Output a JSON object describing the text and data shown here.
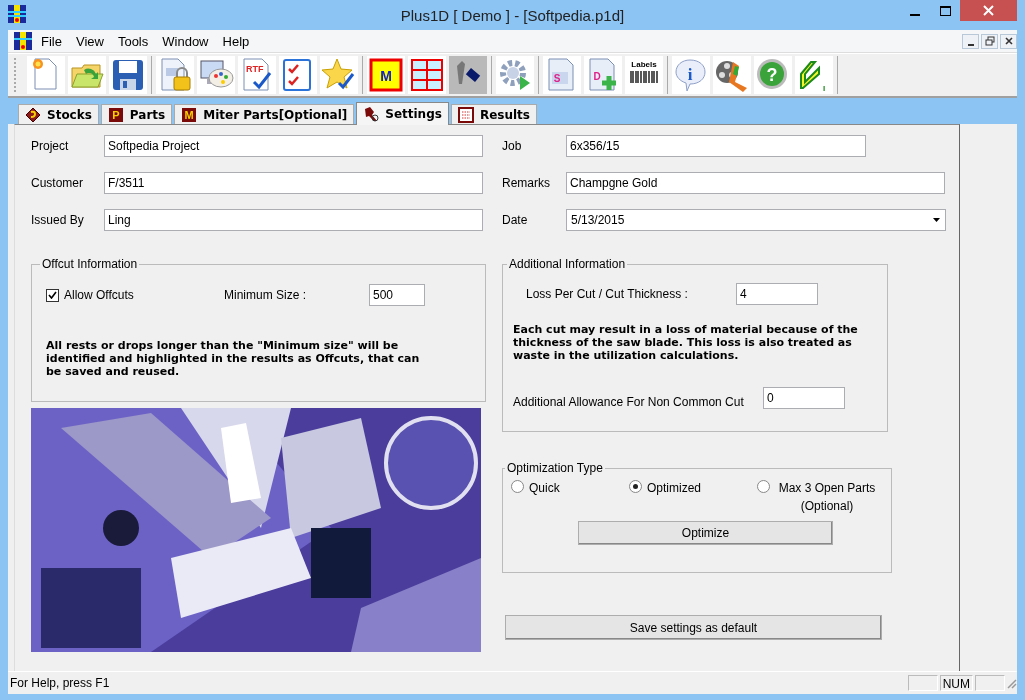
{
  "window": {
    "title": "Plus1D [ Demo ] - [Softpedia.p1d]"
  },
  "menu": [
    {
      "label": "File"
    },
    {
      "label": "View"
    },
    {
      "label": "Tools"
    },
    {
      "label": "Window"
    },
    {
      "label": "Help"
    }
  ],
  "toolbar": [
    [
      {
        "kind": "new-document"
      },
      {
        "kind": "open-folder"
      },
      {
        "kind": "floppy"
      }
    ],
    [
      {
        "kind": "lock-document"
      },
      {
        "kind": "palette"
      },
      {
        "kind": "rtf-document",
        "glyph": "RTF"
      },
      {
        "kind": "checklist"
      },
      {
        "kind": "star-check"
      }
    ],
    [
      {
        "kind": "letter-box",
        "glyph": "M"
      },
      {
        "kind": "grid"
      },
      {
        "kind": "tool",
        "disabled": true
      }
    ],
    [
      {
        "kind": "gear-play"
      }
    ],
    [
      {
        "kind": "letter-document",
        "glyph": "S"
      },
      {
        "kind": "letter-document-plus",
        "glyph": "D"
      },
      {
        "kind": "barcode",
        "glyph": "Labels"
      }
    ],
    [
      {
        "kind": "info",
        "glyph": "i"
      },
      {
        "kind": "film"
      },
      {
        "kind": "help",
        "glyph": "?"
      },
      {
        "kind": "profile",
        "glyph": "I"
      }
    ]
  ],
  "tabs": [
    {
      "label": "Stocks",
      "kind": "stocks",
      "selected": false
    },
    {
      "label": "Parts",
      "kind": "parts",
      "glyph": "P",
      "selected": false
    },
    {
      "label": "Miter Parts[Optional]",
      "kind": "miter",
      "glyph": "M",
      "selected": false
    },
    {
      "label": "Settings",
      "kind": "settings",
      "selected": true
    },
    {
      "label": "Results",
      "kind": "results",
      "selected": false
    }
  ],
  "fields_left": [
    {
      "label": "Project",
      "value": "Softpedia Project",
      "kind": "text"
    },
    {
      "label": "Customer",
      "value": "F/3511",
      "kind": "text"
    },
    {
      "label": "Issued By",
      "value": "Ling",
      "kind": "text"
    }
  ],
  "fields_right": [
    {
      "label": "Job",
      "value": "6x356/15",
      "kind": "short"
    },
    {
      "label": "Remarks",
      "value": "Champgne Gold",
      "kind": "text"
    },
    {
      "label": "Date",
      "value": "5/13/2015",
      "kind": "dropdown"
    }
  ],
  "offcut": {
    "title": "Offcut Information",
    "allow_offcuts": {
      "label": "Allow Offcuts",
      "checked": true
    },
    "minimum_size": {
      "label": "Minimum Size :",
      "value": "500"
    },
    "note": "All rests or drops longer than the \"Minimum size\" will be identified and highlighted in the results as Offcuts, that can be saved and reused."
  },
  "photo": {
    "kind": "picture"
  },
  "additional": {
    "title": "Additional Information",
    "loss": {
      "label": "Loss Per Cut / Cut Thickness :",
      "value": "4"
    },
    "note": "Each cut may result in a loss of material because of the thickness of the saw blade. This loss is also treated as waste in the utilization calculations.",
    "allowance": {
      "label": "Additional Allowance For Non Common Cut",
      "value": "0"
    }
  },
  "optimization": {
    "title": "Optimization Type",
    "options": [
      {
        "label": "Quick",
        "selected": false
      },
      {
        "label": "Optimized",
        "selected": true
      },
      {
        "label": "Max 3 Open Parts (Optional)",
        "selected": false
      }
    ],
    "button": "Optimize"
  },
  "save_button": "Save settings as default",
  "status_bar": {
    "text": "For Help, press F1",
    "panes": [
      {
        "kind": "empty"
      },
      {
        "kind": "indicator",
        "text": "NUM"
      },
      {
        "kind": "empty"
      }
    ]
  }
}
